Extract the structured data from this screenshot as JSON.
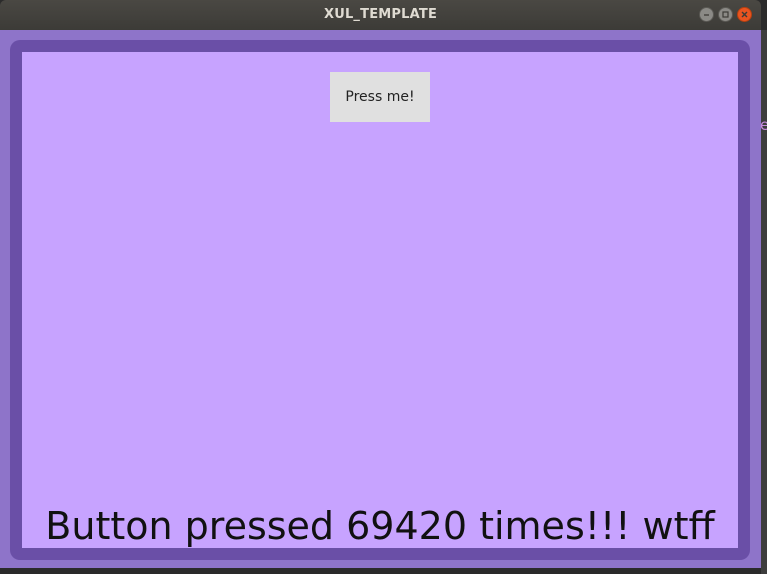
{
  "window": {
    "title": "XUL_TEMPLATE",
    "controls": [
      "minimize-icon",
      "maximize-icon",
      "close-icon"
    ]
  },
  "colors": {
    "titlebar": "#3c3b37",
    "client_background": "#8e74c9",
    "frame": "#6a4fa7",
    "panel": "#c7a3ff",
    "button": "#e0e0e0",
    "close_button": "#e95420"
  },
  "main": {
    "button_label": "Press me!",
    "counter_text": "Button pressed 69420 times!!! wtff"
  },
  "edge_fragment": "e"
}
